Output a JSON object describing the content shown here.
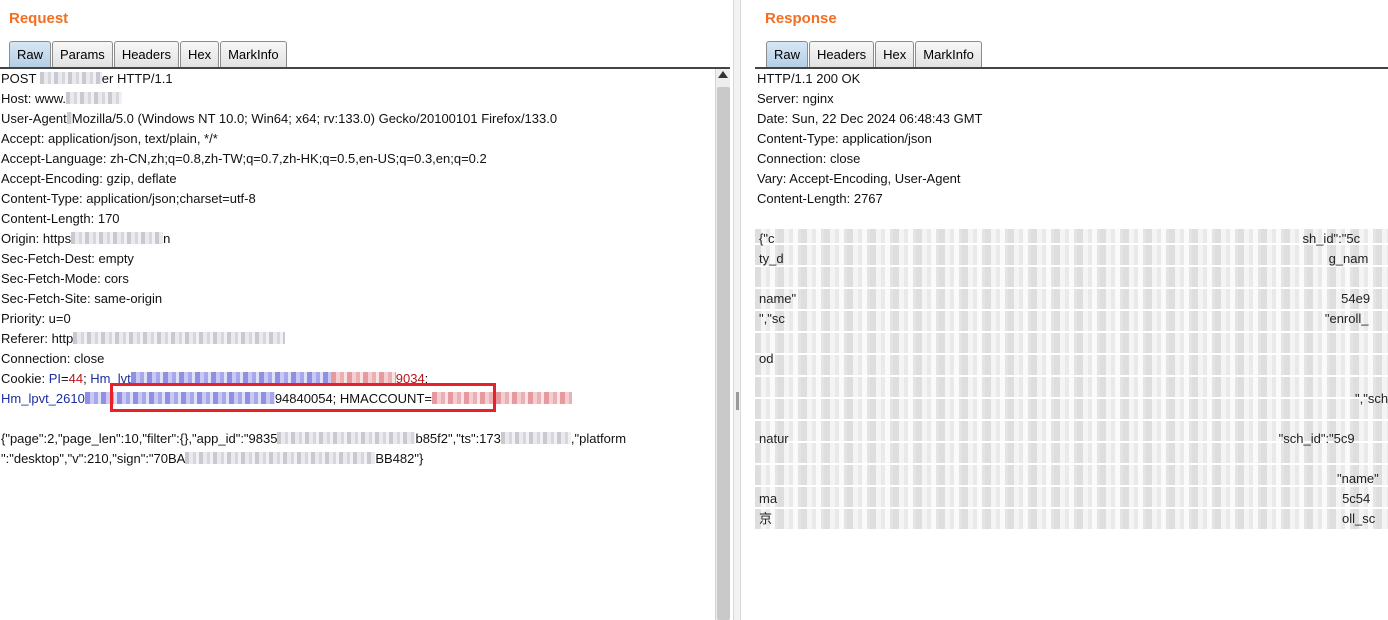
{
  "request": {
    "title": "Request",
    "tabs": [
      "Raw",
      "Params",
      "Headers",
      "Hex",
      "MarkInfo"
    ],
    "active_tab": "Raw",
    "lines": {
      "l1a": "POST ",
      "l1b": "er HTTP/1.1",
      "l2a": "Host: www.",
      "l3a": "User-Agent",
      "l3b": "Mozilla/5.0 (Windows NT 10.0; Win64; x64; rv:133.0) Gecko/20100101 Firefox/133.0",
      "l4": "Accept: application/json, text/plain, */*",
      "l5": "Accept-Language: zh-CN,zh;q=0.8,zh-TW;q=0.7,zh-HK;q=0.5,en-US;q=0.3,en;q=0.2",
      "l6": "Accept-Encoding: gzip, deflate",
      "l7": "Content-Type: application/json;charset=utf-8",
      "l8": "Content-Length: 170",
      "l9a": "Origin: https",
      "l9b": "n",
      "l10": "Sec-Fetch-Dest: empty",
      "l11": "Sec-Fetch-Mode: cors",
      "l12": "Sec-Fetch-Site: same-origin",
      "l13": "Priority: u=0",
      "l14a": "Referer: http",
      "l15": "Connection: close",
      "l16a": "Cookie: ",
      "l16b": "PI",
      "l16c": "=",
      "l16d": "44",
      "l16e": "; ",
      "l16f": "Hm_lvt",
      "l16g": "9034",
      "l16h": ";",
      "l17a": "Hm_lpvt_2610",
      "l17b": "94840054; HMACCOUNT=",
      "l19a": "{\"page\":2,\"page_len\":10,\"filter\":{},\"app_id\":\"9835",
      "l19b": "b85f2\",\"ts\":173",
      "l19c": ",\"platform",
      "l20a": "\":\"desktop\",\"v\":210,\"sign\":\"70BA",
      "l20b": "BB482\"}"
    }
  },
  "response": {
    "title": "Response",
    "tabs": [
      "Raw",
      "Headers",
      "Hex",
      "MarkInfo"
    ],
    "active_tab": "Raw",
    "headers": [
      "HTTP/1.1 200 OK",
      "Server: nginx",
      "Date: Sun, 22 Dec 2024 06:48:43 GMT",
      "Content-Type: application/json",
      "Connection: close",
      "Vary: Accept-Encoding, User-Agent",
      "Content-Length: 2767"
    ],
    "body_fragments": [
      "{\"c",
      "sh_id\":\"5c",
      "ty_d",
      "g_nam",
      "",
      "name\"",
      "54e9",
      "\",\"sc",
      "\"enroll_",
      "",
      "od",
      "",
      "",
      "",
      "",
      "\",\"sch",
      "",
      "",
      "natur",
      "\"sch_id\":\"5c9",
      "",
      "",
      "",
      "\"name\"",
      "ma",
      "5c54",
      "京",
      "oll_sc"
    ]
  }
}
